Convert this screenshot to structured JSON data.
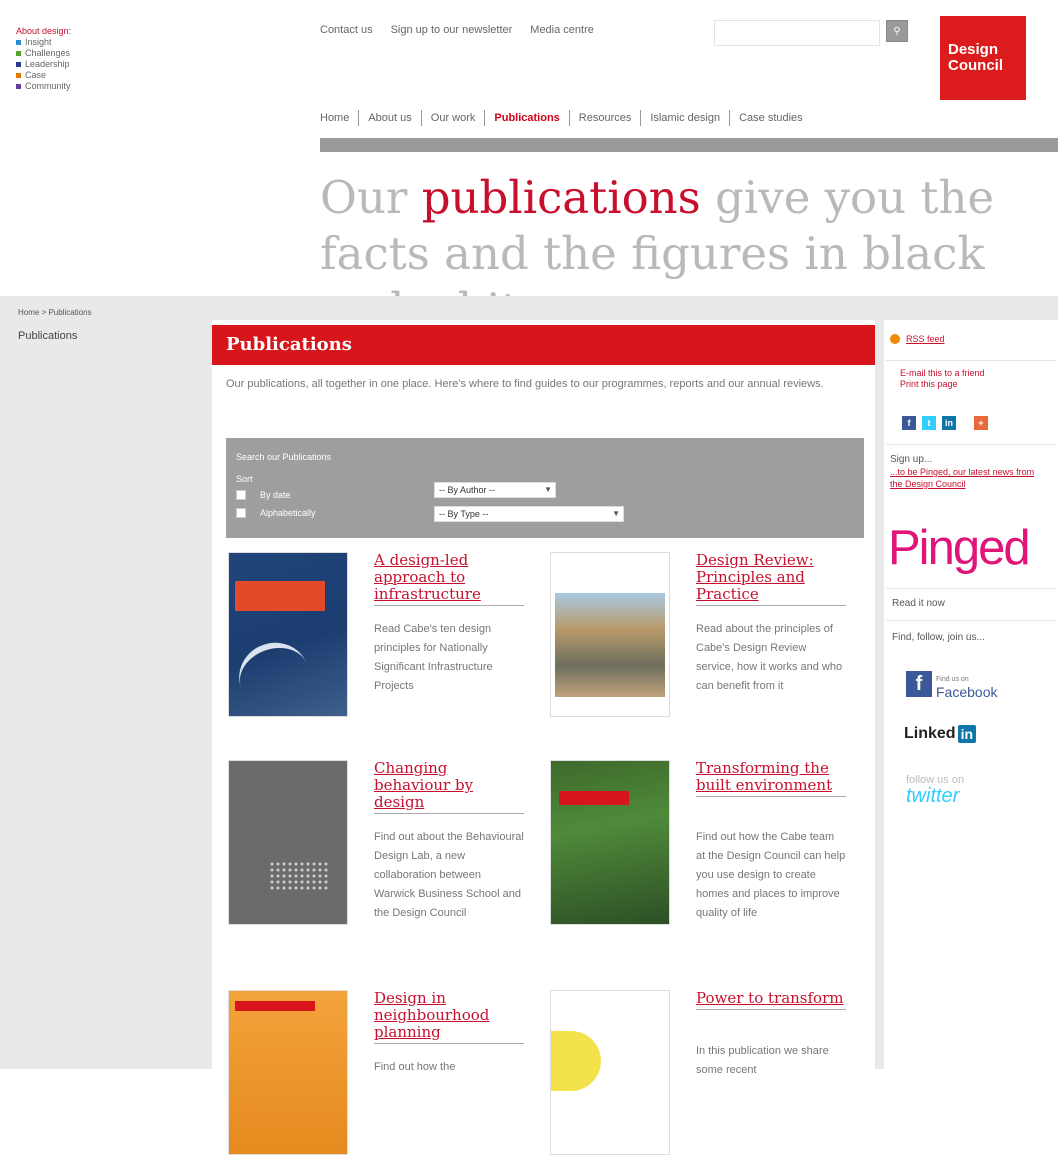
{
  "colors": {
    "brand_red": "#d7151b",
    "grey_bar": "#9a9a9a",
    "band": "#e9e9e9",
    "pinged_pink": "#e0157a"
  },
  "legend": {
    "title": "About design:",
    "items": [
      {
        "label": "Insight",
        "color": "#2a8fd0"
      },
      {
        "label": "Challenges",
        "color": "#5aa02c"
      },
      {
        "label": "Leadership",
        "color": "#2b3a8c"
      },
      {
        "label": "Case",
        "color": "#e07b00"
      },
      {
        "label": "Community",
        "color": "#6b3c9b"
      }
    ]
  },
  "toplinks": [
    "Contact us",
    "Sign up to our newsletter",
    "Media centre"
  ],
  "search": {
    "placeholder": "",
    "button_icon": "search-icon"
  },
  "logo": {
    "line1": "Design",
    "line2": "Council"
  },
  "nav": [
    {
      "label": "Home",
      "active": false
    },
    {
      "label": "About us",
      "active": false
    },
    {
      "label": "Our work",
      "active": false
    },
    {
      "label": "Publications",
      "active": true
    },
    {
      "label": "Resources",
      "active": false
    },
    {
      "label": "Islamic design",
      "active": false
    },
    {
      "label": "Case studies",
      "active": false
    }
  ],
  "hero": {
    "pre": "Our ",
    "highlight": "publications",
    "post": " give you the facts and the figures in black and white"
  },
  "breadcrumb": "Home > Publications",
  "left_title": "Publications",
  "content": {
    "heading": "Publications",
    "intro": "Our publications, all together in one place. Here's where to find guides to our programmes, reports and our annual reviews."
  },
  "filter": {
    "title": "Search our Publications",
    "sort_label": "Sort",
    "options": [
      "By date",
      "Alphabetically"
    ],
    "author_select": "-- By Author --",
    "type_select": "-- By Type --"
  },
  "publications": [
    {
      "title": "A design-led approach to infrastructure",
      "desc": "Read Cabe's ten design principles for Nationally Significant Infrastructure Projects"
    },
    {
      "title": "Design Review: Principles and Practice",
      "desc": "Read about the principles of Cabe's Design Review service, how it works and who can benefit from it"
    },
    {
      "title": "Changing behaviour by design",
      "desc": "Find out about the Behavioural Design Lab, a new collaboration between Warwick Business School and the Design Council"
    },
    {
      "title": "Transforming the built environment",
      "desc": "Find out how the Cabe team at the Design Council can help you use design to create homes and places to improve quality of life"
    },
    {
      "title": "Design in neighbourhood planning",
      "desc": "Find out how the"
    },
    {
      "title": "Power to transform",
      "desc": "In this publication we share some recent"
    }
  ],
  "sidebar": {
    "rss": "RSS feed",
    "share": [
      "E-mail this to a friend",
      "Print this page"
    ],
    "signup_title": "Sign up...",
    "signup_sub": "...to be Pinged, our latest news from the Design Council",
    "pinged": "Pinged",
    "read_now": "Read it now",
    "follow": "Find, follow, join us...",
    "facebook": "Facebook",
    "facebook_small": "Find us on",
    "linkedin": "Linked",
    "linkedin_in": "in",
    "twitter_small": "follow us on",
    "twitter": "twitter"
  }
}
